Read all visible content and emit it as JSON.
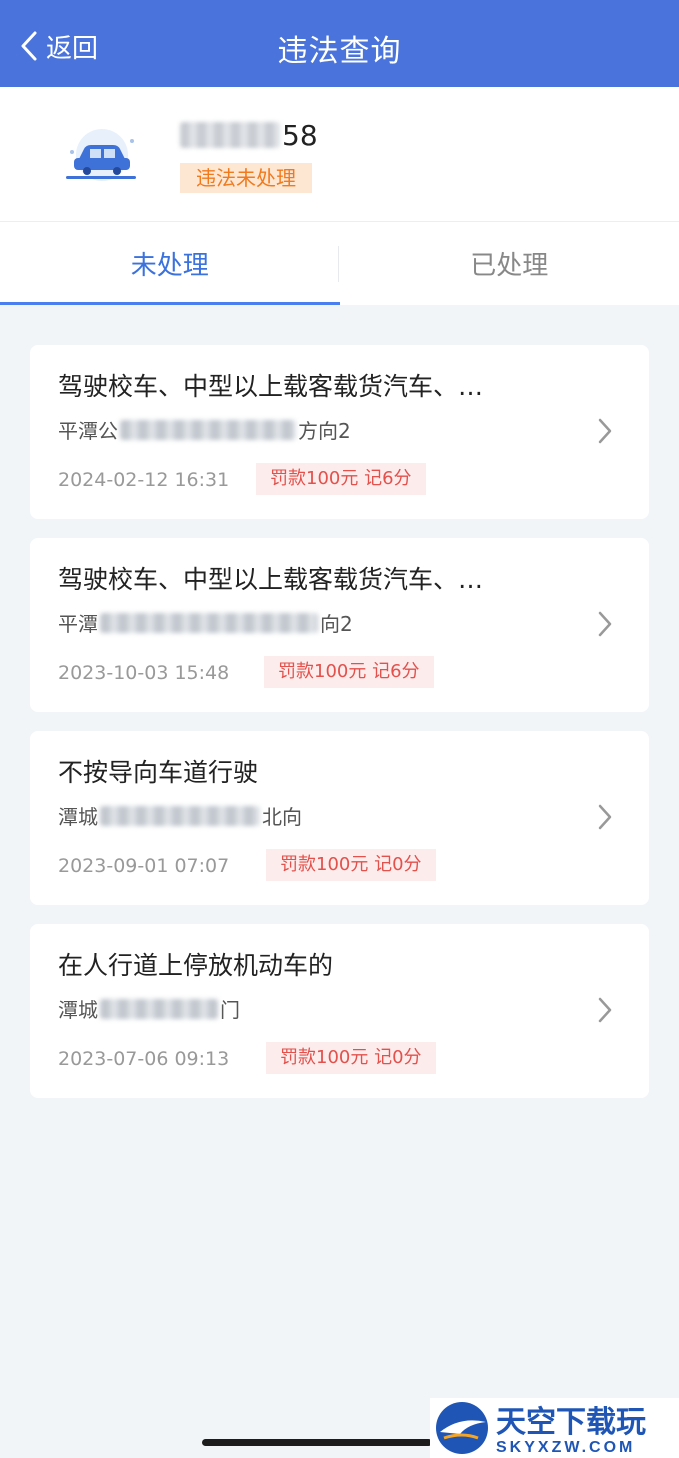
{
  "nav": {
    "back_label": "返回",
    "title": "违法查询"
  },
  "vehicle": {
    "plate_visible": "58",
    "status": "违法未处理"
  },
  "tabs": [
    {
      "label": "未处理",
      "active": true
    },
    {
      "label": "已处理",
      "active": false
    }
  ],
  "violations": [
    {
      "title": "驾驶校车、中型以上载客载货汽车、…",
      "loc_prefix": "平潭公",
      "loc_suffix": "方向2",
      "time": "2024-02-12 16:31",
      "fine": "罚款100元 记6分"
    },
    {
      "title": "驾驶校车、中型以上载客载货汽车、…",
      "loc_prefix": "平潭",
      "loc_suffix": "向2",
      "time": "2023-10-03 15:48",
      "fine": "罚款100元 记6分"
    },
    {
      "title": "不按导向车道行驶",
      "loc_prefix": "潭城",
      "loc_suffix": "北向",
      "time": "2023-09-01 07:07",
      "fine": "罚款100元 记0分"
    },
    {
      "title": "在人行道上停放机动车的",
      "loc_prefix": "潭城",
      "loc_suffix": "门",
      "time": "2023-07-06 09:13",
      "fine": "罚款100元 记0分"
    }
  ],
  "watermark": {
    "brand": "天空下载玩",
    "domain": "SKYXZW.COM"
  },
  "colors": {
    "nav": "#4a74db",
    "accent": "#3b72dd",
    "status_bg": "#fde6d2",
    "status_text": "#f07a1e",
    "fine_bg": "#fdecec",
    "fine_text": "#e2514c"
  },
  "icons": {
    "back": "chevron-left-icon",
    "car": "car-icon",
    "detail": "chevron-right-icon"
  }
}
